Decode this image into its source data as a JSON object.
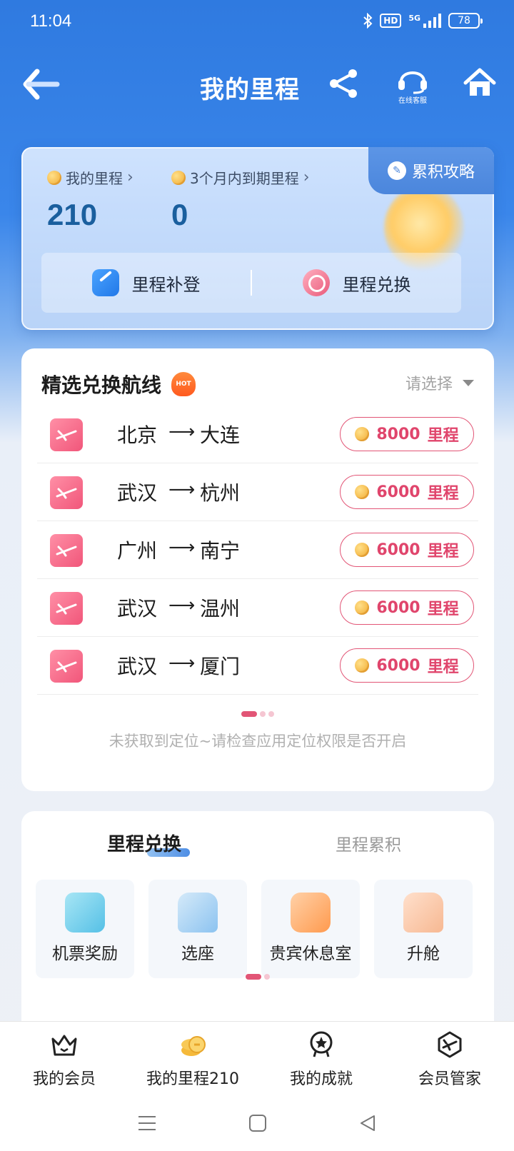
{
  "status_bar": {
    "time": "11:04",
    "network": "5G",
    "hd": "HD",
    "battery": "78"
  },
  "nav": {
    "title": "我的里程",
    "service_label": "在线客服"
  },
  "miles_card": {
    "tab_label": "累积攻略",
    "my_miles_label": "我的里程",
    "my_miles_value": "210",
    "expiring_label": "3个月内到期里程",
    "expiring_value": "0",
    "actions": [
      {
        "label": "里程补登"
      },
      {
        "label": "里程兑换"
      }
    ]
  },
  "routes": {
    "title": "精选兑换航线",
    "hot_badge": "HOT",
    "select_placeholder": "请选择",
    "arrow": "⟶",
    "items": [
      {
        "from": "北京",
        "to": "大连",
        "miles": "8000",
        "unit": "里程"
      },
      {
        "from": "武汉",
        "to": "杭州",
        "miles": "6000",
        "unit": "里程"
      },
      {
        "from": "广州",
        "to": "南宁",
        "miles": "6000",
        "unit": "里程"
      },
      {
        "from": "武汉",
        "to": "温州",
        "miles": "6000",
        "unit": "里程"
      },
      {
        "from": "武汉",
        "to": "厦门",
        "miles": "6000",
        "unit": "里程"
      }
    ],
    "location_tip": "未获取到定位~请检查应用定位权限是否开启"
  },
  "exchange": {
    "tabs": [
      {
        "label": "里程兑换",
        "active": true
      },
      {
        "label": "里程累积",
        "active": false
      }
    ],
    "tiles": [
      {
        "label": "机票奖励",
        "icon": "ticket-gift-icon"
      },
      {
        "label": "选座",
        "icon": "seat-icon"
      },
      {
        "label": "贵宾休息室",
        "icon": "lounge-sofa-icon"
      },
      {
        "label": "升舱",
        "icon": "upgrade-seat-icon"
      }
    ]
  },
  "bottom_nav": {
    "items": [
      {
        "label": "我的会员",
        "icon": "crown-icon"
      },
      {
        "label": "我的里程210",
        "icon": "miles-coin-icon"
      },
      {
        "label": "我的成就",
        "icon": "medal-icon"
      },
      {
        "label": "会员管家",
        "icon": "plane-badge-icon"
      }
    ]
  },
  "colors": {
    "primary_blue": "#2f7ae0",
    "accent_pink": "#e25576",
    "coin_gold": "#f0a629"
  }
}
